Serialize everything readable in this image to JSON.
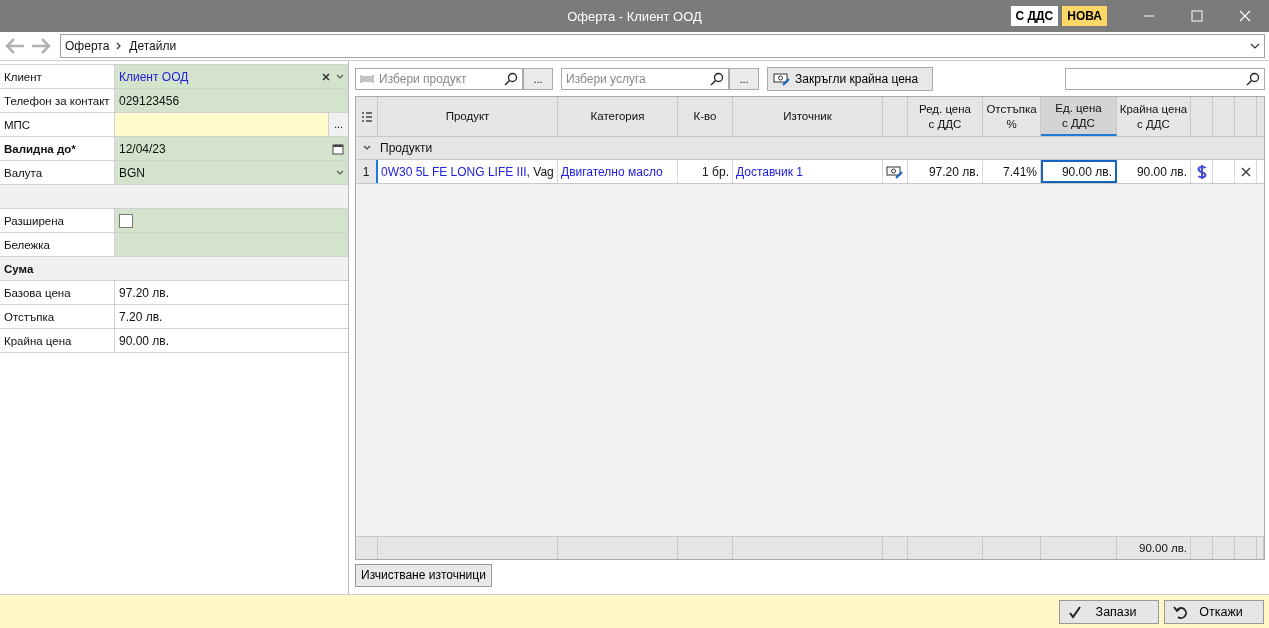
{
  "window": {
    "title": "Оферта - Клиент ООД",
    "badges": [
      {
        "label": "С ДДС",
        "color": "#ffffff"
      },
      {
        "label": "НОВА",
        "color": "#fcd667"
      }
    ]
  },
  "nav": {
    "back_disabled": true,
    "forward_disabled": true,
    "breadcrumb": [
      "Оферта",
      "Детайли"
    ]
  },
  "form": [
    {
      "kind": "combo",
      "label": "Клиент",
      "value": "Клиент ООД",
      "required": false
    },
    {
      "kind": "text",
      "label": "Телефон за контакт",
      "value": "029123456",
      "required": false
    },
    {
      "kind": "lookup",
      "label": "МПС",
      "button": "...",
      "required": false
    },
    {
      "kind": "date",
      "label": "Валидна до*",
      "value": "12/04/23",
      "required": true
    },
    {
      "kind": "select",
      "label": "Валута",
      "value": "BGN",
      "required": false
    },
    {
      "kind": "gap"
    },
    {
      "kind": "checkbox",
      "label": "Разширена",
      "checked": false,
      "required": false
    },
    {
      "kind": "text",
      "label": "Бележка",
      "required": false
    },
    {
      "kind": "section",
      "label": "Сума"
    },
    {
      "kind": "readonly",
      "label": "Базова цена",
      "value": "97.20 лв.",
      "required": false
    },
    {
      "kind": "readonly",
      "label": "Отстъпка",
      "value": "7.20 лв.",
      "required": false
    },
    {
      "kind": "readonly",
      "label": "Крайна цена",
      "value": "90.00 лв.",
      "required": false
    }
  ],
  "toolbar": {
    "product_search": {
      "placeholder": "Избери продукт",
      "button": "..."
    },
    "service_search": {
      "placeholder": "Избери услуга",
      "button": "..."
    },
    "round_button": "Закръгли крайна цена"
  },
  "grid": {
    "columns": [
      {
        "label": "Продукт",
        "sorted": false
      },
      {
        "label": "Категория",
        "sorted": false
      },
      {
        "label": "К-во",
        "sorted": false
      },
      {
        "label": "Източник",
        "sorted": false
      },
      {
        "sorted": false
      },
      {
        "label": "Ред. цена\nс ДДС",
        "sorted": false
      },
      {
        "label": "Отстъпка\n%",
        "sorted": false
      },
      {
        "label": "Ед. цена\nс ДДС",
        "sorted": true
      },
      {
        "label": "Крайна цена\nс ДДС",
        "sorted": false
      }
    ],
    "group": {
      "label": "Продукти",
      "expanded": true
    },
    "rows": [
      {
        "index": "1",
        "product": "0W30 5L FE LONG LIFE III",
        "product_suffix": ", Vag",
        "category": "Двигателно масло",
        "quantity": "1 бр.",
        "source": "Доставчик 1",
        "prices": [
          {
            "value": "97.20 лв.",
            "focused": false
          },
          {
            "value": "7.41%",
            "focused": false
          },
          {
            "value": "90.00 лв.",
            "focused": true
          },
          {
            "value": "90.00 лв.",
            "focused": false
          }
        ]
      }
    ],
    "footer_total": "90.00 лв."
  },
  "clear_sources_button": "Изчистване източници",
  "actions": [
    {
      "kind": "save",
      "label": "Запази"
    },
    {
      "kind": "cancel",
      "label": "Откажи"
    }
  ]
}
